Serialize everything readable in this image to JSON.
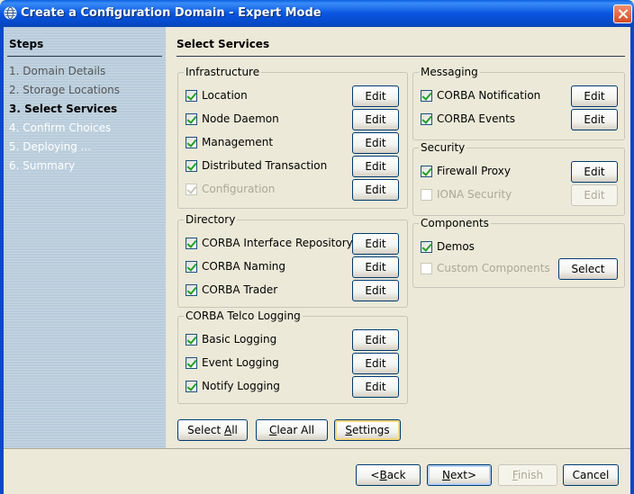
{
  "window": {
    "title": "Create a Configuration Domain - Expert Mode",
    "title_icon": "globe-icon",
    "close_icon": "close-icon"
  },
  "sidebar": {
    "title": "Steps",
    "steps": [
      {
        "label": "1. Domain Details",
        "state": "done"
      },
      {
        "label": "2. Storage Locations",
        "state": "done"
      },
      {
        "label": "3. Select Services",
        "state": "active"
      },
      {
        "label": "4. Confirm Choices",
        "state": "future"
      },
      {
        "label": "5. Deploying ...",
        "state": "future"
      },
      {
        "label": "6. Summary",
        "state": "future"
      }
    ]
  },
  "main": {
    "title": "Select Services",
    "groups": {
      "infrastructure": {
        "legend": "Infrastructure",
        "items": [
          {
            "label": "Location",
            "checked": true,
            "enabled": true,
            "button": "Edit",
            "button_enabled": true
          },
          {
            "label": "Node Daemon",
            "checked": true,
            "enabled": true,
            "button": "Edit",
            "button_enabled": true
          },
          {
            "label": "Management",
            "checked": true,
            "enabled": true,
            "button": "Edit",
            "button_enabled": true
          },
          {
            "label": "Distributed Transaction",
            "checked": true,
            "enabled": true,
            "button": "Edit",
            "button_enabled": true
          },
          {
            "label": "Configuration",
            "checked": true,
            "enabled": false,
            "button": "Edit",
            "button_enabled": true
          }
        ]
      },
      "directory": {
        "legend": "Directory",
        "items": [
          {
            "label": "CORBA Interface Repository",
            "checked": true,
            "enabled": true,
            "button": "Edit",
            "button_enabled": true
          },
          {
            "label": "CORBA Naming",
            "checked": true,
            "enabled": true,
            "button": "Edit",
            "button_enabled": true
          },
          {
            "label": "CORBA Trader",
            "checked": true,
            "enabled": true,
            "button": "Edit",
            "button_enabled": true
          }
        ]
      },
      "telco_logging": {
        "legend": "CORBA Telco Logging",
        "items": [
          {
            "label": "Basic Logging",
            "checked": true,
            "enabled": true,
            "button": "Edit",
            "button_enabled": true
          },
          {
            "label": "Event Logging",
            "checked": true,
            "enabled": true,
            "button": "Edit",
            "button_enabled": true
          },
          {
            "label": "Notify Logging",
            "checked": true,
            "enabled": true,
            "button": "Edit",
            "button_enabled": true
          }
        ]
      },
      "messaging": {
        "legend": "Messaging",
        "items": [
          {
            "label": "CORBA Notification",
            "checked": true,
            "enabled": true,
            "button": "Edit",
            "button_enabled": true
          },
          {
            "label": "CORBA Events",
            "checked": true,
            "enabled": true,
            "button": "Edit",
            "button_enabled": true
          }
        ]
      },
      "security": {
        "legend": "Security",
        "items": [
          {
            "label": "Firewall Proxy",
            "checked": true,
            "enabled": true,
            "button": "Edit",
            "button_enabled": true
          },
          {
            "label": "IONA Security",
            "checked": false,
            "enabled": false,
            "button": "Edit",
            "button_enabled": false
          }
        ]
      },
      "components": {
        "legend": "Components",
        "items": [
          {
            "label": "Demos",
            "checked": true,
            "enabled": true
          },
          {
            "label": "Custom Components",
            "checked": false,
            "enabled": false,
            "button": "Select",
            "button_enabled": true
          }
        ]
      }
    },
    "actions": {
      "select_all_pre": "Select ",
      "select_all_mn": "A",
      "select_all_post": "ll",
      "clear_all_pre": "",
      "clear_all_mn": "C",
      "clear_all_post": "lear All",
      "settings_pre": "",
      "settings_mn": "S",
      "settings_post": "ettings"
    }
  },
  "footer": {
    "back_pre": "<",
    "back_mn": "B",
    "back_post": "ack",
    "next_pre": "",
    "next_mn": "N",
    "next_post": "ext>",
    "finish_pre": "",
    "finish_mn": "F",
    "finish_post": "inish",
    "cancel": "Cancel"
  }
}
